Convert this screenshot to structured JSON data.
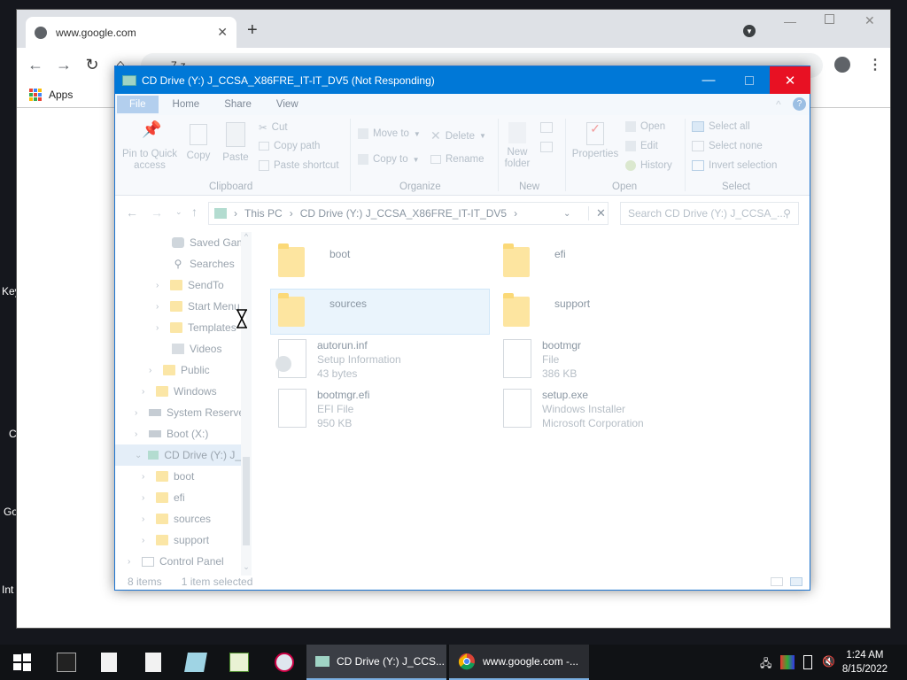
{
  "desktop": {
    "labels": [
      "Key",
      "C",
      "Go",
      "Int"
    ]
  },
  "chrome": {
    "tab_title": "www.google.com",
    "omnibox_text": "7-z",
    "bookmarks": {
      "apps_label": "Apps"
    }
  },
  "explorer": {
    "title": "CD Drive (Y:) J_CCSA_X86FRE_IT-IT_DV5 (Not Responding)",
    "ribbon_tabs": [
      "File",
      "Home",
      "Share",
      "View"
    ],
    "ribbon": {
      "pin_label_1": "Pin to Quick",
      "pin_label_2": "access",
      "copy": "Copy",
      "paste": "Paste",
      "cut": "Cut",
      "copy_path": "Copy path",
      "paste_shortcut": "Paste shortcut",
      "move_to": "Move to",
      "copy_to": "Copy to",
      "delete": "Delete",
      "rename": "Rename",
      "new_folder_1": "New",
      "new_folder_2": "folder",
      "properties": "Properties",
      "open": "Open",
      "edit": "Edit",
      "history": "History",
      "select_all": "Select all",
      "select_none": "Select none",
      "invert_selection": "Invert selection",
      "groups": {
        "clipboard": "Clipboard",
        "organize": "Organize",
        "new": "New",
        "open": "Open",
        "select": "Select"
      }
    },
    "address": {
      "crumb1": "This PC",
      "crumb2": "CD Drive (Y:) J_CCSA_X86FRE_IT-IT_DV5"
    },
    "search_placeholder": "Search CD Drive (Y:) J_CCSA_...",
    "nav": [
      {
        "label": "Saved Gam"
      },
      {
        "label": "Searches"
      },
      {
        "label": "SendTo"
      },
      {
        "label": "Start Menu"
      },
      {
        "label": "Templates"
      },
      {
        "label": "Videos"
      },
      {
        "label": "Public"
      },
      {
        "label": "Windows"
      },
      {
        "label": "System Reserve"
      },
      {
        "label": "Boot (X:)"
      },
      {
        "label": "CD Drive (Y:) J_"
      },
      {
        "label": "boot"
      },
      {
        "label": "efi"
      },
      {
        "label": "sources"
      },
      {
        "label": "support"
      },
      {
        "label": "Control Panel"
      }
    ],
    "items": [
      {
        "name": "boot"
      },
      {
        "name": "efi"
      },
      {
        "name": "sources"
      },
      {
        "name": "support"
      },
      {
        "name": "autorun.inf",
        "line2": "Setup Information",
        "line3": "43 bytes"
      },
      {
        "name": "bootmgr",
        "line2": "File",
        "line3": "386 KB"
      },
      {
        "name": "bootmgr.efi",
        "line2": "EFI File",
        "line3": "950 KB"
      },
      {
        "name": "setup.exe",
        "line2": "Windows Installer",
        "line3": "Microsoft Corporation"
      }
    ],
    "status": {
      "count": "8 items",
      "selected": "1 item selected"
    }
  },
  "taskbar": {
    "task_explorer": "CD Drive (Y:) J_CCS...",
    "task_chrome": "www.google.com -...",
    "time": "1:24 AM",
    "date": "8/15/2022"
  }
}
